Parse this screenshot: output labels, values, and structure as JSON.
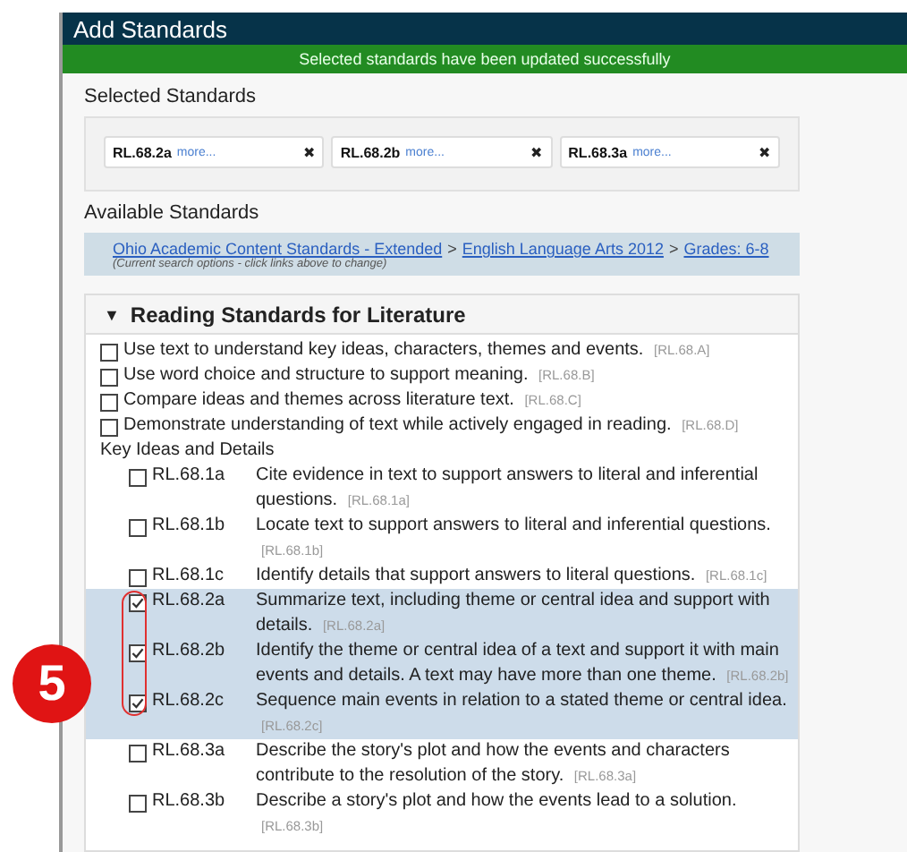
{
  "dialog": {
    "title": "Add Standards"
  },
  "notice": "Selected standards have been updated successfully",
  "selected_heading": "Selected Standards",
  "selected": [
    {
      "code": "RL.68.2a",
      "more": "more...",
      "remove": "✖"
    },
    {
      "code": "RL.68.2b",
      "more": "more...",
      "remove": "✖"
    },
    {
      "code": "RL.68.3a",
      "more": "more...",
      "remove": "✖"
    }
  ],
  "available_heading": "Available Standards",
  "breadcrumb": {
    "links": [
      "Ohio Academic Content Standards - Extended",
      "English Language Arts 2012",
      "Grades: 6-8"
    ],
    "separator": ">",
    "hint": "(Current search options - click links above to change)"
  },
  "section": {
    "caret": "▼",
    "title": "Reading Standards for Literature",
    "expanded": true
  },
  "items": [
    {
      "kind": "top",
      "text": "Use text to understand key ideas, characters, themes and events.",
      "ref": "[RL.68.A]",
      "checked": false,
      "selected": false
    },
    {
      "kind": "top",
      "text": "Use word choice and structure to support meaning.",
      "ref": "[RL.68.B]",
      "checked": false,
      "selected": false
    },
    {
      "kind": "top",
      "text": "Compare ideas and themes across literature text.",
      "ref": "[RL.68.C]",
      "checked": false,
      "selected": false
    },
    {
      "kind": "top",
      "text": "Demonstrate understanding of text while actively engaged in reading.",
      "ref": "[RL.68.D]",
      "checked": false,
      "selected": false
    },
    {
      "kind": "group",
      "text": "Key Ideas and Details"
    },
    {
      "kind": "sub",
      "code": "RL.68.1a",
      "text": "Cite evidence in text to support answers to literal and inferential questions.",
      "ref": "[RL.68.1a]",
      "checked": false,
      "selected": false
    },
    {
      "kind": "sub",
      "code": "RL.68.1b",
      "text": "Locate text to support answers to literal and inferential questions.",
      "ref": "[RL.68.1b]",
      "checked": false,
      "selected": false
    },
    {
      "kind": "sub",
      "code": "RL.68.1c",
      "text": "Identify details that support answers to literal questions.",
      "ref": "[RL.68.1c]",
      "checked": false,
      "selected": false
    },
    {
      "kind": "sub",
      "code": "RL.68.2a",
      "text": "Summarize text, including theme or central idea and support with details.",
      "ref": "[RL.68.2a]",
      "checked": true,
      "selected": true
    },
    {
      "kind": "sub",
      "code": "RL.68.2b",
      "text": "Identify the theme or central idea of a text and support it with main events and details. A text may have more than one theme.",
      "ref": "[RL.68.2b]",
      "checked": true,
      "selected": true
    },
    {
      "kind": "sub",
      "code": "RL.68.2c",
      "text": "Sequence main events in relation to a stated theme or central idea.",
      "ref": "[RL.68.2c]",
      "checked": true,
      "selected": true
    },
    {
      "kind": "sub",
      "code": "RL.68.3a",
      "text": "Describe the story's plot and how the events and characters contribute to the resolution of the story.",
      "ref": "[RL.68.3a]",
      "checked": false,
      "selected": false
    },
    {
      "kind": "sub",
      "code": "RL.68.3b",
      "text": "Describe a story's plot and how the events lead to a solution.",
      "ref": "[RL.68.3b]",
      "checked": false,
      "selected": false
    }
  ],
  "step_badge": "5"
}
